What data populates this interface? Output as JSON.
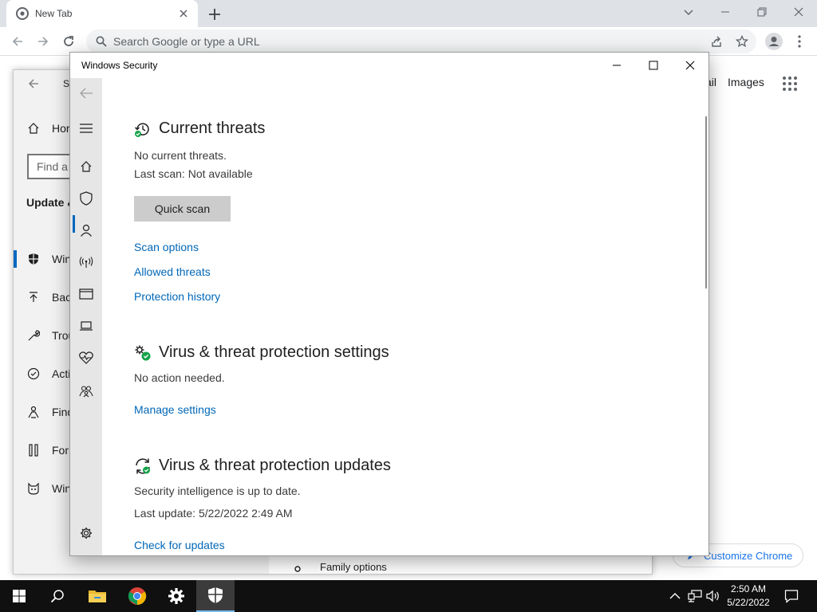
{
  "chrome": {
    "tab_title": "New Tab",
    "omnibox_placeholder": "Search Google or type a URL",
    "ntp_links": [
      "ail",
      "Images"
    ],
    "customize_label": "Customize Chrome"
  },
  "settings_window": {
    "title": "Se",
    "search_placeholder": "Find a s",
    "heading": "Update &",
    "nav_items": [
      {
        "label": "Hor",
        "icon": "home-icon"
      },
      {
        "label": "Win",
        "icon": "shield-icon"
      },
      {
        "label": "Back",
        "icon": "backup-arrow-icon"
      },
      {
        "label": "Trou",
        "icon": "wrench-icon"
      },
      {
        "label": "Acti",
        "icon": "check-circle-icon"
      },
      {
        "label": "Find",
        "icon": "person-location-icon"
      },
      {
        "label": "For",
        "icon": "tools-icon"
      },
      {
        "label": "Win",
        "icon": "cat-icon"
      }
    ],
    "family_options": "Family options"
  },
  "security_window": {
    "title": "Windows Security",
    "sections": {
      "current_threats": {
        "title": "Current threats",
        "status": "No current threats.",
        "last_scan": "Last scan: Not available",
        "button": "Quick scan",
        "links": [
          "Scan options",
          "Allowed threats",
          "Protection history"
        ]
      },
      "settings": {
        "title": "Virus & threat protection settings",
        "status": "No action needed.",
        "link": "Manage settings"
      },
      "updates": {
        "title": "Virus & threat protection updates",
        "status": "Security intelligence is up to date.",
        "last_update": "Last update: 5/22/2022 2:49 AM",
        "link": "Check for updates"
      }
    },
    "sidebar_icons": [
      "back-arrow-icon",
      "hamburger-menu-icon",
      "home-icon",
      "shield-icon",
      "account-icon",
      "firewall-network-icon",
      "app-browser-icon",
      "device-security-icon",
      "health-heart-icon",
      "family-icon",
      "settings-gear-icon"
    ]
  },
  "taskbar": {
    "time": "2:50 AM",
    "date": "5/22/2022",
    "accent": "#76b9ed"
  },
  "colors": {
    "link": "#0067b8",
    "selection": "#0067c0",
    "success_green": "#16a34a"
  }
}
